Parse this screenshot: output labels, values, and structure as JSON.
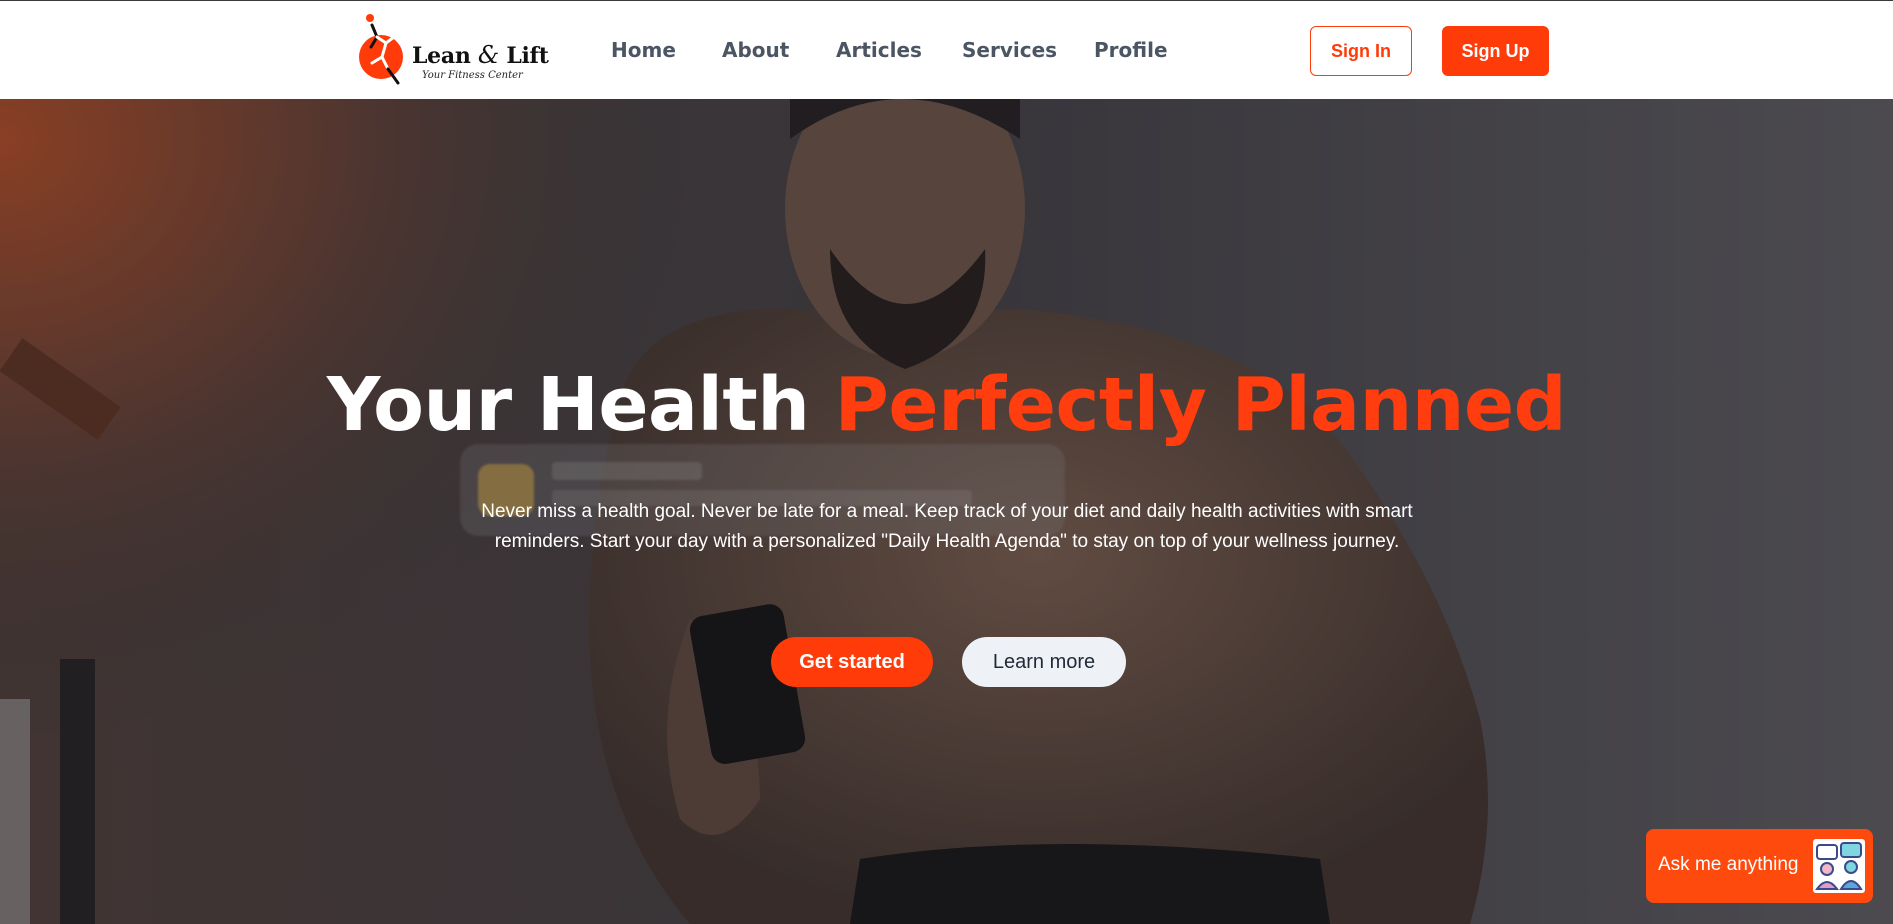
{
  "brand": {
    "name_part1": "Lean ",
    "ampersand": "&",
    "name_part2": " Lift",
    "tagline": "Your Fitness Center",
    "logo_icon": "runner-logo-icon"
  },
  "nav": {
    "links": [
      {
        "label": "Home"
      },
      {
        "label": "About"
      },
      {
        "label": "Articles"
      },
      {
        "label": "Services"
      },
      {
        "label": "Profile"
      }
    ],
    "sign_in": "Sign In",
    "sign_up": "Sign Up"
  },
  "hero": {
    "title_white": "Your Health ",
    "title_accent": "Perfectly Planned",
    "description": "Never miss a health goal. Never be late for a meal. Keep track of your diet and daily health activities with smart reminders. Start your day with a personalized \"Daily Health Agenda\" to stay on top of your wellness journey.",
    "primary_cta": "Get started",
    "secondary_cta": "Learn more",
    "background_image": "man-checking-phone-photo"
  },
  "chat_widget": {
    "label": "Ask me anything",
    "icon": "chat-people-icon"
  },
  "colors": {
    "accent": "#ff3b0a",
    "nav_text": "#4b5563",
    "hero_overlay": "#1a1a1f",
    "secondary_button_bg": "#eef2f6"
  }
}
